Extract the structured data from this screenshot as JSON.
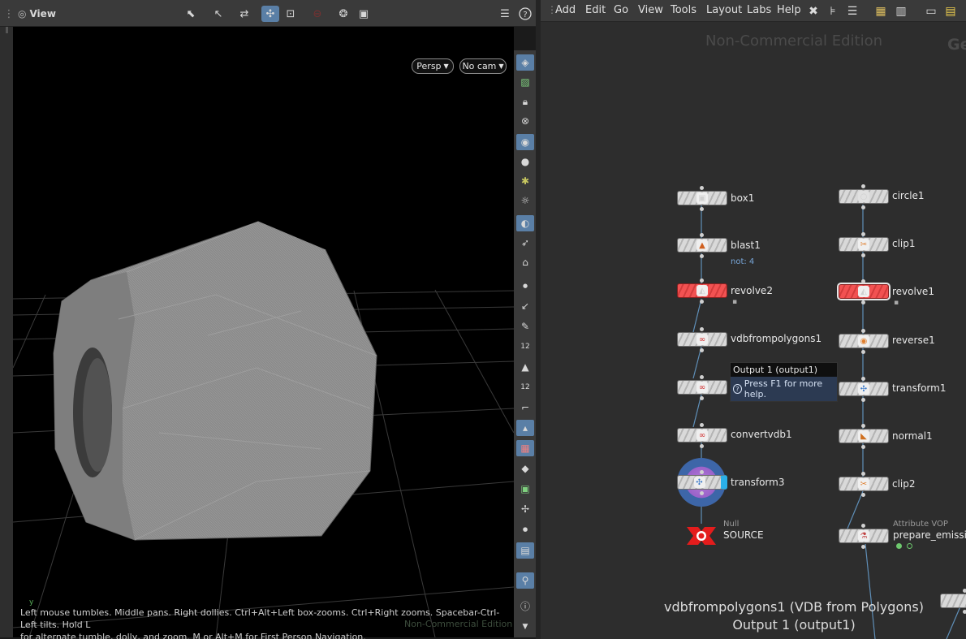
{
  "viewport": {
    "title": "View",
    "camera_menu": "Persp",
    "cam_menu": "No cam",
    "help_line1": "Left mouse tumbles. Middle pans. Right dollies. Ctrl+Alt+Left box-zooms. Ctrl+Right zooms. Spacebar-Ctrl-Left tilts. Hold L",
    "help_line2": "for alternate tumble, dolly, and zoom.      M or Alt+M for First Person Navigation.",
    "watermark": "Non-Commercial Edition",
    "axis_label": "y",
    "side_tool_labels": {
      "snap_12a": "12",
      "snap_12b": "12"
    }
  },
  "menubar": {
    "items": [
      "Add",
      "Edit",
      "Go",
      "View",
      "Tools",
      "Layout",
      "Labs",
      "Help"
    ]
  },
  "network": {
    "watermark": "Non-Commercial Edition",
    "partial_title": "Ge",
    "nodes_left": {
      "box1": "box1",
      "blast1": "blast1",
      "blast1_note": "not: 4",
      "revolve2": "revolve2",
      "vdbfrompolygons1": "vdbfrompolygons1",
      "convertvdb1": "convertvdb1",
      "transform3": "transform3",
      "null_type": "Null",
      "source": "SOURCE"
    },
    "nodes_right": {
      "circle1": "circle1",
      "clip1": "clip1",
      "revolve1": "revolve1",
      "reverse1": "reverse1",
      "transform1": "transform1",
      "normal1": "normal1",
      "clip2": "clip2",
      "vop_type": "Attribute VOP",
      "prepare_emission": "prepare_emissio"
    },
    "tooltip": {
      "title": "Output 1 (output1)",
      "help": "Press F1 for more help."
    },
    "footer": {
      "line1": "vdbfrompolygons1 (VDB from Polygons)",
      "line2": "Output 1 (output1)"
    }
  },
  "colors": {
    "bypass_red": "#f25252",
    "selection_blue": "#5a7fa6",
    "wire": "#5f8fb8"
  }
}
